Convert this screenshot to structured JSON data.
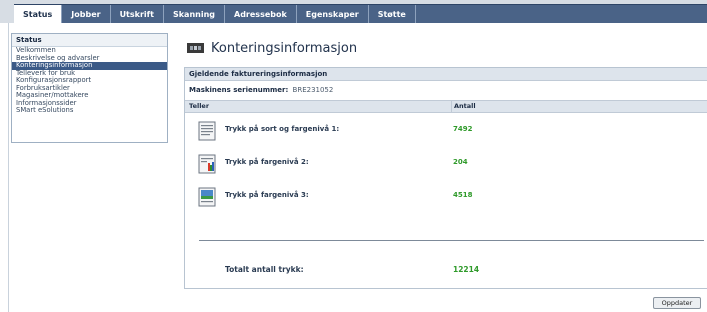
{
  "tabs": [
    {
      "label": "Status",
      "active": true
    },
    {
      "label": "Jobber"
    },
    {
      "label": "Utskrift"
    },
    {
      "label": "Skanning"
    },
    {
      "label": "Adressebok"
    },
    {
      "label": "Egenskaper"
    },
    {
      "label": "Støtte"
    }
  ],
  "sidebar": {
    "title": "Status",
    "items": [
      {
        "label": "Velkommen"
      },
      {
        "label": "Beskrivelse og advarsler"
      },
      {
        "label": "Konteringsinformasjon",
        "active": true
      },
      {
        "label": "Telleverk for bruk"
      },
      {
        "label": "Konfigurasjonsrapport"
      },
      {
        "label": "Forbruksartikler"
      },
      {
        "label": "Magasiner/mottakere"
      },
      {
        "label": "Informasjonssider"
      },
      {
        "label": "SMart eSolutions"
      }
    ]
  },
  "page": {
    "title": "Konteringsinformasjon"
  },
  "panel": {
    "heading": "Gjeldende faktureringsinformasjon",
    "serial_label": "Maskinens serienummer:",
    "serial_value": "BRE231052",
    "col_counter": "Teller",
    "col_count": "Antall"
  },
  "meters": [
    {
      "label": "Trykk på sort og fargenivå 1:",
      "value": "7492",
      "icon": "black-print-icon"
    },
    {
      "label": "Trykk på fargenivå 2:",
      "value": "204",
      "icon": "color-level-2-icon"
    },
    {
      "label": "Trykk på fargenivå 3:",
      "value": "4518",
      "icon": "color-level-3-icon"
    }
  ],
  "total": {
    "label": "Totalt antall trykk:",
    "value": "12214"
  },
  "update_button": "Oppdater",
  "colors": {
    "tab_bar": "#4a6387",
    "active_side": "#3b5a87",
    "value_green": "#2f9a2a",
    "header_bg": "#dde4ec"
  }
}
